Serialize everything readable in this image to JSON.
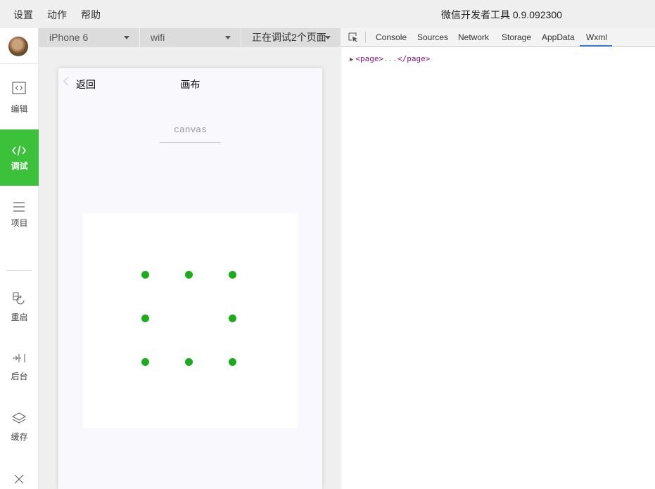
{
  "menubar": {
    "items": [
      "设置",
      "动作",
      "帮助"
    ],
    "app_title": "微信开发者工具 0.9.092300"
  },
  "sidebar": {
    "items": [
      {
        "label": "编辑",
        "icon": "code-window-icon"
      },
      {
        "label": "调试",
        "icon": "code-icon",
        "active": true
      },
      {
        "label": "项目",
        "icon": "menu-icon"
      },
      {
        "label": "重启",
        "icon": "restart-icon"
      },
      {
        "label": "后台",
        "icon": "background-icon"
      },
      {
        "label": "缓存",
        "icon": "layers-icon"
      }
    ],
    "close_icon": "close-icon"
  },
  "simulator_toolbar": {
    "device": "iPhone 6",
    "network": "wifi",
    "debug_pages": "正在调试2个页面"
  },
  "phone": {
    "back_label": "返回",
    "page_title": "画布",
    "canvas_caption": "canvas",
    "dot_color": "#1aad19"
  },
  "devtools": {
    "tabs": [
      "Console",
      "Sources",
      "Network",
      "Storage",
      "AppData",
      "Wxml"
    ],
    "active_tab": "Wxml",
    "tree": {
      "open_tag": "<page>",
      "ellipsis": "...",
      "close_tag": "</page>"
    }
  }
}
